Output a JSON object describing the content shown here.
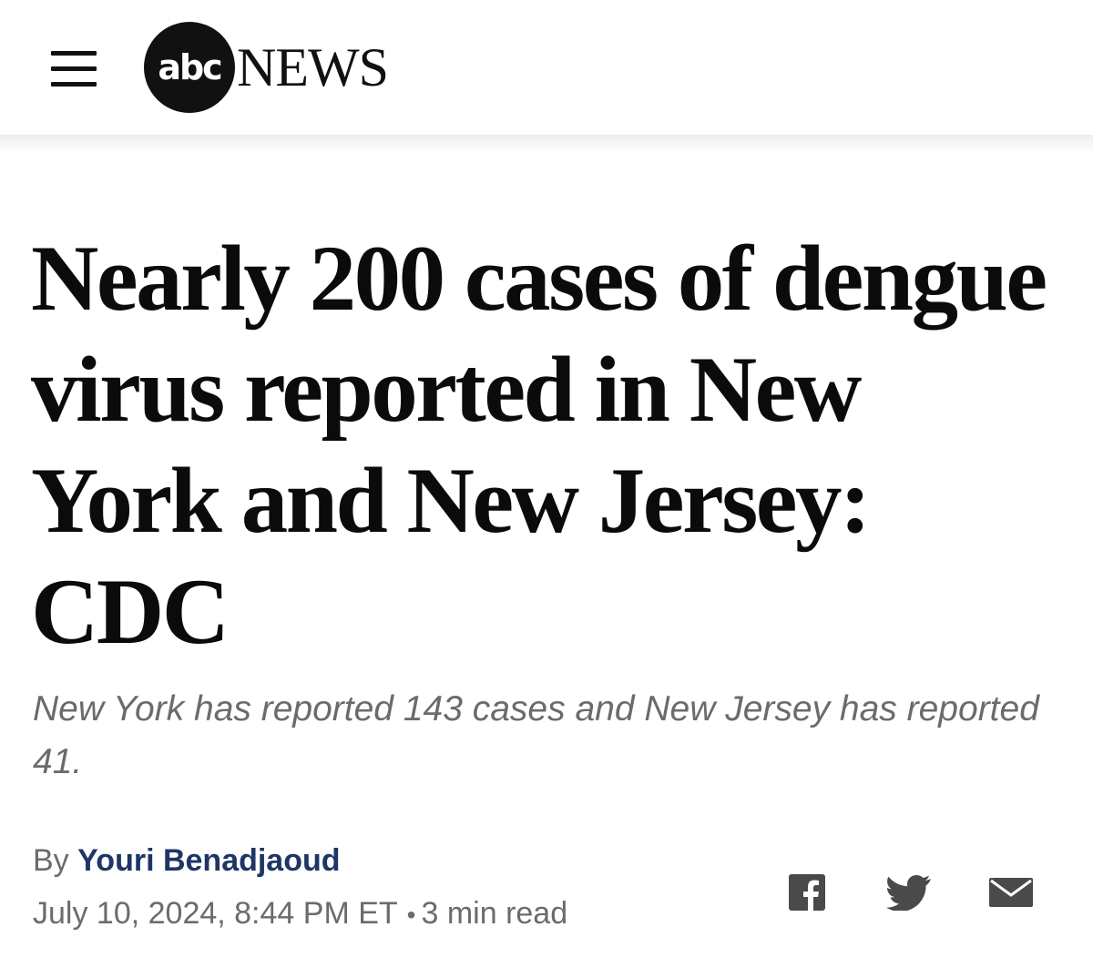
{
  "header": {
    "logo_circle_text": "abc",
    "logo_news_text": "NEWS",
    "menu_icon": "hamburger-menu-icon"
  },
  "article": {
    "headline": "Nearly 200 cases of dengue virus reported in New York and New Jersey: CDC",
    "subheadline": "New York has reported 143 cases and New Jersey has reported 41.",
    "byline_prefix": "By",
    "author": "Youri Benadjaoud",
    "date": "July 10, 2024, 8:44 PM ET",
    "separator": "•",
    "read_time": "3 min read"
  },
  "share": {
    "icons": [
      "facebook-icon",
      "twitter-icon",
      "email-icon"
    ]
  },
  "colors": {
    "text_dark": "#0b0b0b",
    "text_gray": "#6b6b6b",
    "author_blue": "#1f3566",
    "icon_gray": "#4a4a4a"
  }
}
